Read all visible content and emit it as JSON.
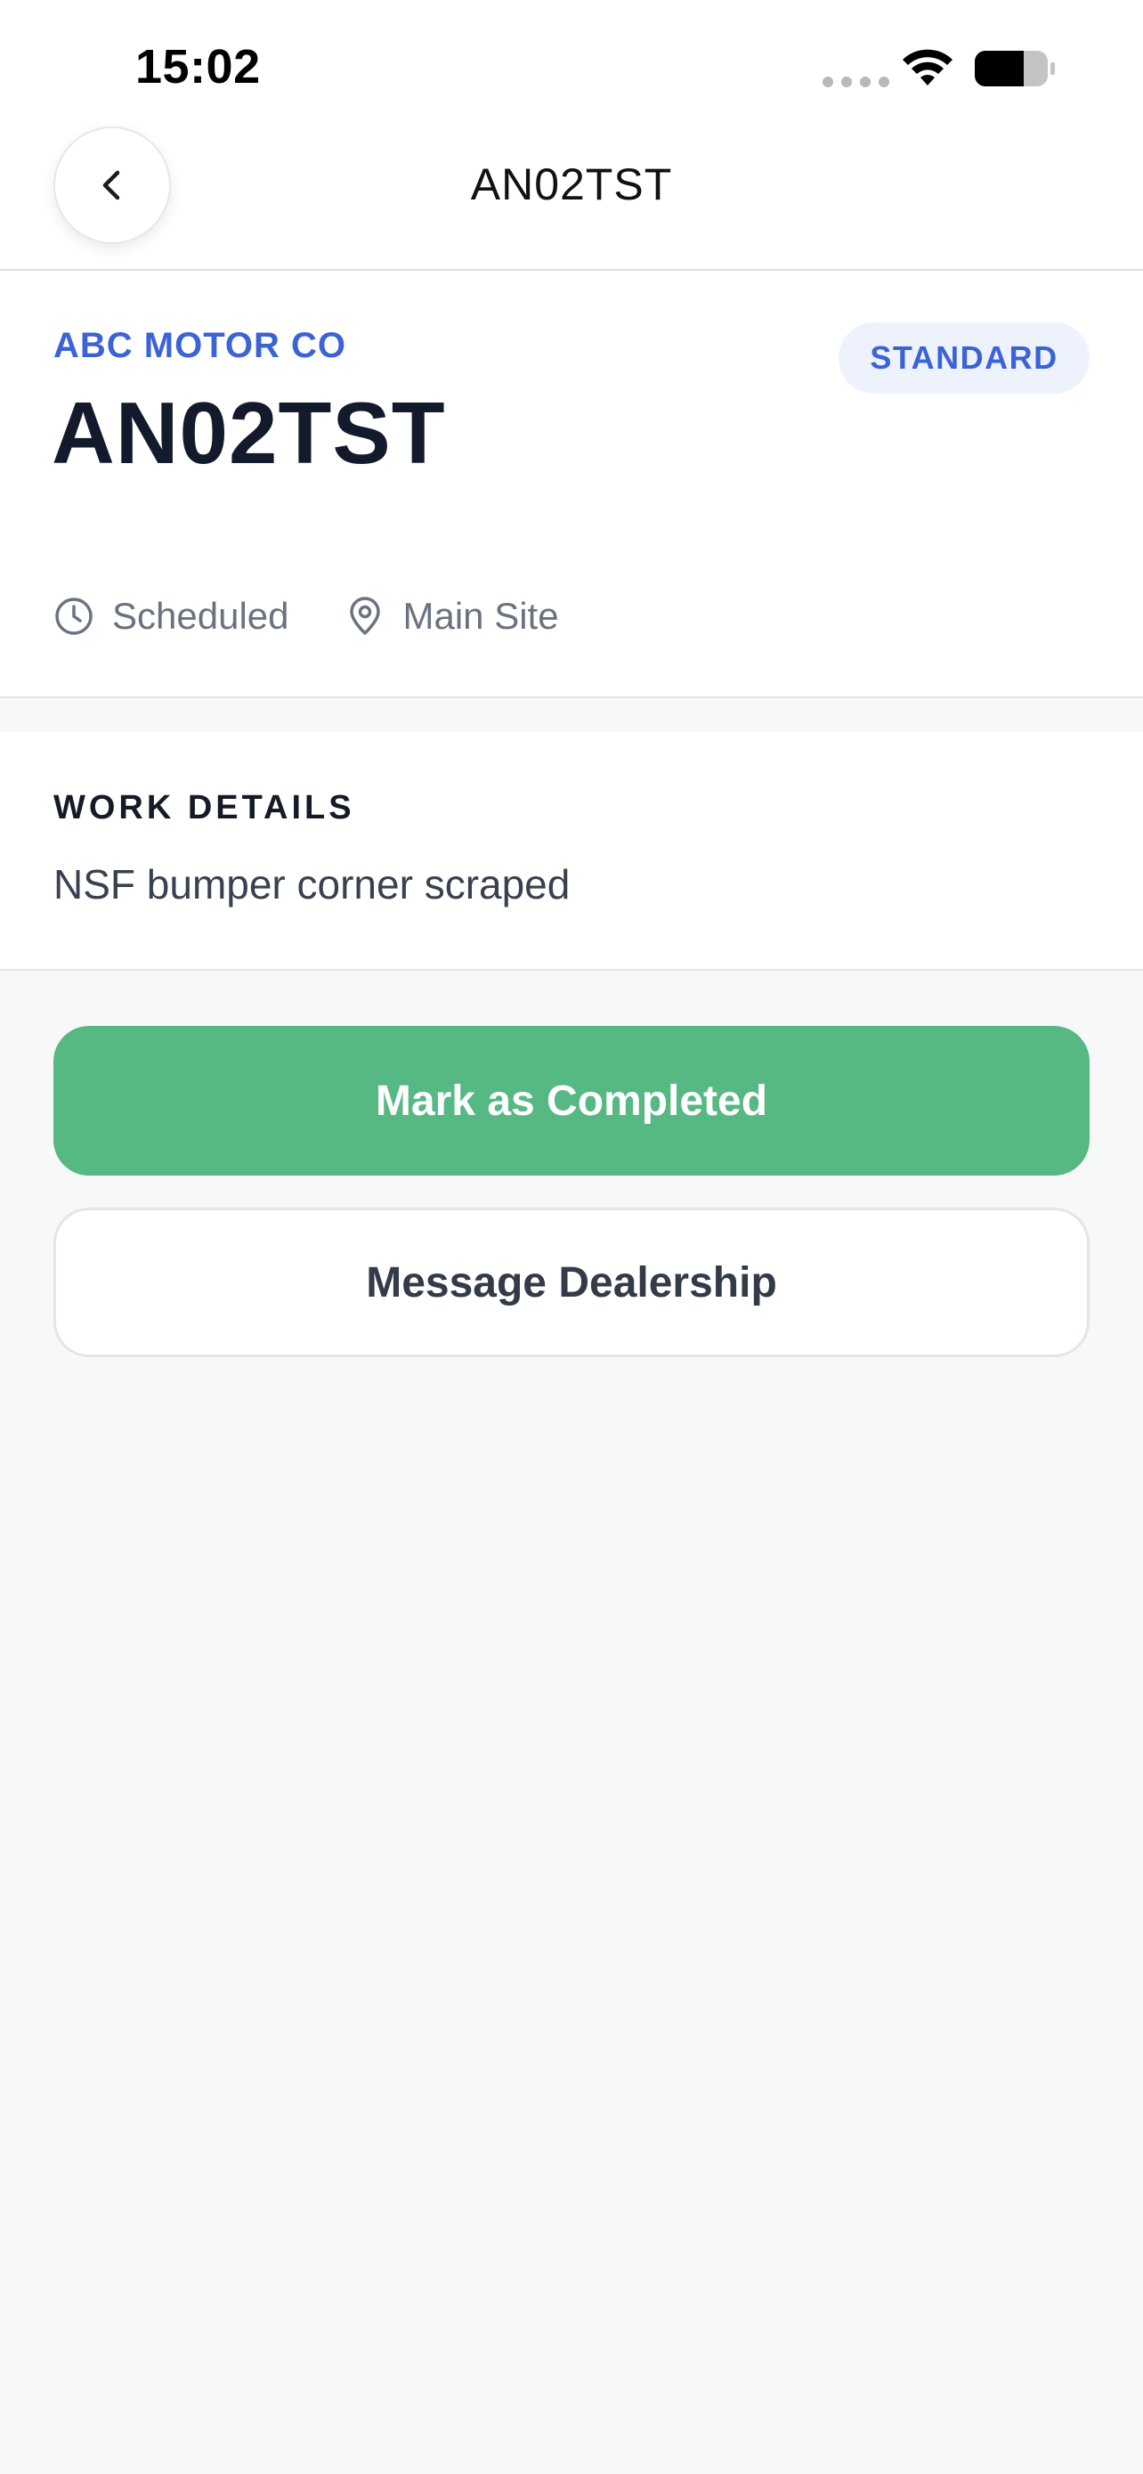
{
  "status_bar": {
    "time": "15:02"
  },
  "nav": {
    "title": "AN02TST",
    "back_icon": "chevron-left-icon"
  },
  "job": {
    "dealer_name": "ABC MOTOR CO",
    "registration": "AN02TST",
    "type_badge": "STANDARD",
    "status": "Scheduled",
    "status_icon": "clock-icon",
    "location": "Main Site",
    "location_icon": "map-pin-icon"
  },
  "work_details": {
    "heading": "WORK DETAILS",
    "description": "NSF bumper corner scraped"
  },
  "actions": {
    "primary_label": "Mark as Completed",
    "secondary_label": "Message Dealership"
  },
  "colors": {
    "accent_blue": "#3b63d6",
    "badge_bg": "#edf2fd",
    "success_green": "#56b883",
    "page_bg": "#f7f8f8"
  }
}
